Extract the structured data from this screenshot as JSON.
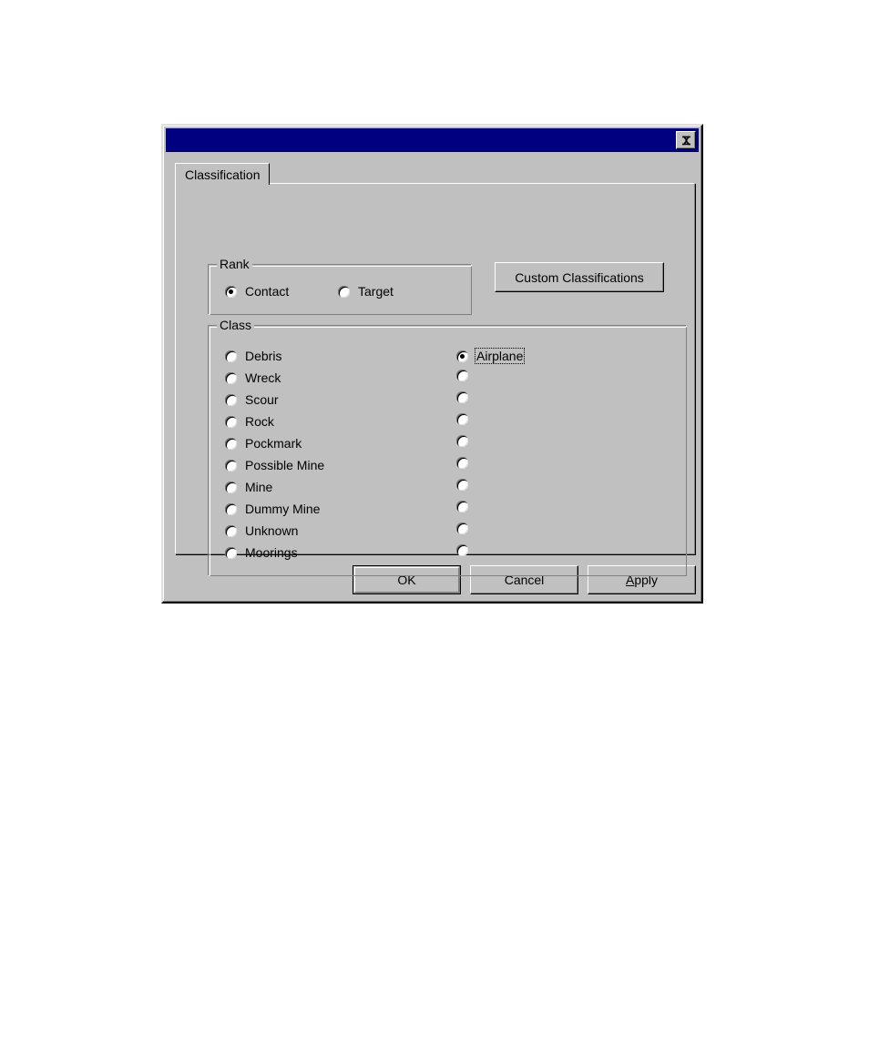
{
  "window": {
    "title": "",
    "close_button": {
      "icon": "close-icon",
      "label": "×"
    }
  },
  "tabs": [
    {
      "id": "classification",
      "label": "Classification",
      "selected": true
    }
  ],
  "rank_group": {
    "label": "Rank",
    "options": [
      {
        "label": "Contact",
        "checked": true
      },
      {
        "label": "Target",
        "checked": false
      }
    ]
  },
  "custom_classifications_button": {
    "label": "Custom Classifications"
  },
  "class_group": {
    "label": "Class",
    "left_column": [
      {
        "label": "Debris",
        "checked": false
      },
      {
        "label": "Wreck",
        "checked": false
      },
      {
        "label": "Scour",
        "checked": false
      },
      {
        "label": "Rock",
        "checked": false
      },
      {
        "label": "Pockmark",
        "checked": false
      },
      {
        "label": "Possible Mine",
        "checked": false
      },
      {
        "label": "Mine",
        "checked": false
      },
      {
        "label": "Dummy Mine",
        "checked": false
      },
      {
        "label": "Unknown",
        "checked": false
      },
      {
        "label": "Moorings",
        "checked": false
      }
    ],
    "right_column": [
      {
        "label": "Airplane",
        "checked": true,
        "focused": true
      },
      {
        "label": "",
        "checked": false
      },
      {
        "label": "",
        "checked": false
      },
      {
        "label": "",
        "checked": false
      },
      {
        "label": "",
        "checked": false
      },
      {
        "label": "",
        "checked": false
      },
      {
        "label": "",
        "checked": false
      },
      {
        "label": "",
        "checked": false
      },
      {
        "label": "",
        "checked": false
      },
      {
        "label": "",
        "checked": false
      }
    ]
  },
  "buttons": {
    "ok": {
      "label": "OK",
      "default": true
    },
    "cancel": {
      "label": "Cancel",
      "default": false
    },
    "apply": {
      "label": "Apply",
      "accelerator": "A",
      "default": false
    }
  },
  "colors": {
    "window_face": "#c0c0c0",
    "titlebar_active": "#000080",
    "shadow": "#808080",
    "highlight": "#ffffff",
    "text": "#000000"
  }
}
